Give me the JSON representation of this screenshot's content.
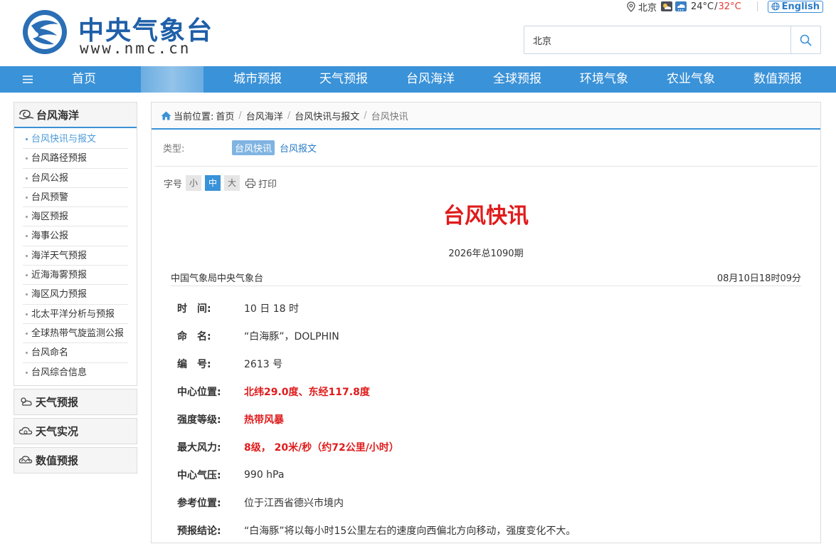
{
  "header": {
    "logo_cn": "中央气象台",
    "logo_url": "www.nmc.cn",
    "city": "北京",
    "temp_low": "24°C",
    "temp_sep": "/",
    "temp_high": "32°C",
    "english_label": "English",
    "search_value": "北京"
  },
  "nav": {
    "items": [
      "首页",
      "城市预报",
      "天气预报",
      "台风海洋",
      "全球预报",
      "环境气象",
      "农业气象",
      "数值预报"
    ]
  },
  "sidebar": {
    "head": "台风海洋",
    "items": [
      {
        "label": "台风快讯与报文",
        "active": true
      },
      {
        "label": "台风路径预报"
      },
      {
        "label": "台风公报"
      },
      {
        "label": "台风预警"
      },
      {
        "label": "海区预报"
      },
      {
        "label": "海事公报"
      },
      {
        "label": "海洋天气预报"
      },
      {
        "label": "近海海雾预报"
      },
      {
        "label": "海区风力预报"
      },
      {
        "label": "北太平洋分析与预报"
      },
      {
        "label": "全球热带气旋监测公报"
      },
      {
        "label": "台风命名"
      },
      {
        "label": "台风综合信息"
      }
    ],
    "sections": [
      "天气预报",
      "天气实况",
      "数值预报"
    ]
  },
  "breadcrumb": {
    "prefix": "当前位置:",
    "items": [
      "首页",
      "台风海洋",
      "台风快讯与报文",
      "台风快讯"
    ]
  },
  "type_row": {
    "label": "类型:",
    "active": "台风快讯",
    "other": "台风报文"
  },
  "font_row": {
    "label": "字号",
    "small": "小",
    "medium": "中",
    "large": "大",
    "print": "打印"
  },
  "article": {
    "title": "台风快讯",
    "issue": "2026年总1090期",
    "agency": "中国气象局中央气象台",
    "time": "08月10日18时09分",
    "fields": [
      {
        "label": "时　间:",
        "value": "10 日 18 时",
        "red": false
      },
      {
        "label": "命　名:",
        "value": "“白海豚”，DOLPHIN",
        "red": false
      },
      {
        "label": "编　号:",
        "value": "2613 号",
        "red": false
      },
      {
        "label": "中心位置:",
        "value": "北纬29.0度、东经117.8度",
        "red": true
      },
      {
        "label": "强度等级:",
        "value": "热带风暴",
        "red": true
      },
      {
        "label": "最大风力:",
        "value": "8级， 20米/秒（约72公里/小时）",
        "red": true
      },
      {
        "label": "中心气压:",
        "value": "990 hPa",
        "red": false
      },
      {
        "label": "参考位置:",
        "value": "位于江西省德兴市境内",
        "red": false
      },
      {
        "label": "预报结论:",
        "value": "“白海豚”将以每小时15公里左右的速度向西偏北方向移动，强度变化不大。",
        "red": false
      }
    ]
  }
}
